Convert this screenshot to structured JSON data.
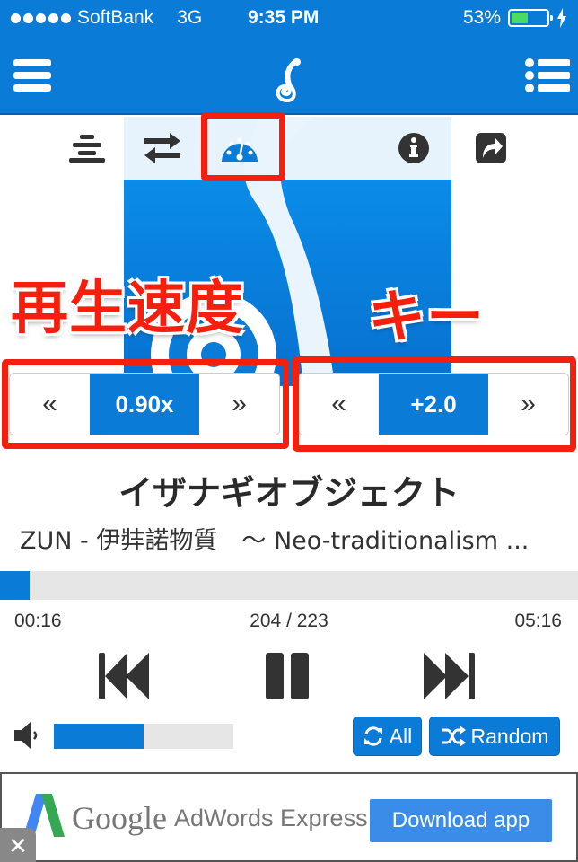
{
  "status_bar": {
    "signal_dots": 5,
    "carrier": "SoftBank",
    "network": "3G",
    "time": "9:35 PM",
    "battery_percent_label": "53%",
    "battery_level": 0.53,
    "charging": true
  },
  "nav": {
    "menu_icon": "hamburger-menu-icon",
    "logo_icon": "swirl-note-logo",
    "playlist_icon": "list-icon"
  },
  "toolbar": {
    "items": [
      {
        "name": "align-center-icon",
        "label": "Lyrics"
      },
      {
        "name": "exchange-icon",
        "label": "Repeat/AB"
      },
      {
        "name": "dashboard-speed-icon",
        "label": "Speed",
        "active": true
      },
      {
        "name": "info-icon",
        "label": "Info"
      },
      {
        "name": "share-icon",
        "label": "Share"
      }
    ]
  },
  "callouts": {
    "speed_label": "再生速度",
    "key_label": "キー"
  },
  "speed_stepper": {
    "decrease": "«",
    "value": "0.90x",
    "increase": "»"
  },
  "key_stepper": {
    "decrease": "«",
    "value": "+2.0",
    "increase": "»"
  },
  "track": {
    "title": "イザナギオブジェクト",
    "subtitle": "ZUN - 伊弉諾物質　～ Neo-traditionalism ..."
  },
  "playback": {
    "elapsed": "00:16",
    "position": "204 / 223",
    "duration": "05:16",
    "progress_fraction": 0.051
  },
  "controls": {
    "previous_icon": "fast-backward-icon",
    "pause_icon": "pause-icon",
    "next_icon": "fast-forward-icon"
  },
  "volume": {
    "level": 0.5
  },
  "modes": {
    "repeat_label": "All",
    "shuffle_label": "Random"
  },
  "ad": {
    "brand": "Google",
    "product": "AdWords Express",
    "cta": "Download app",
    "close": "✕",
    "colors": {
      "blue": "#4285f4",
      "green": "#34a853",
      "button": "#3b8be8"
    }
  },
  "colors": {
    "primary": "#0a7bd6",
    "annotation_red": "#f4200d",
    "track_bg": "#e6e6e6"
  }
}
